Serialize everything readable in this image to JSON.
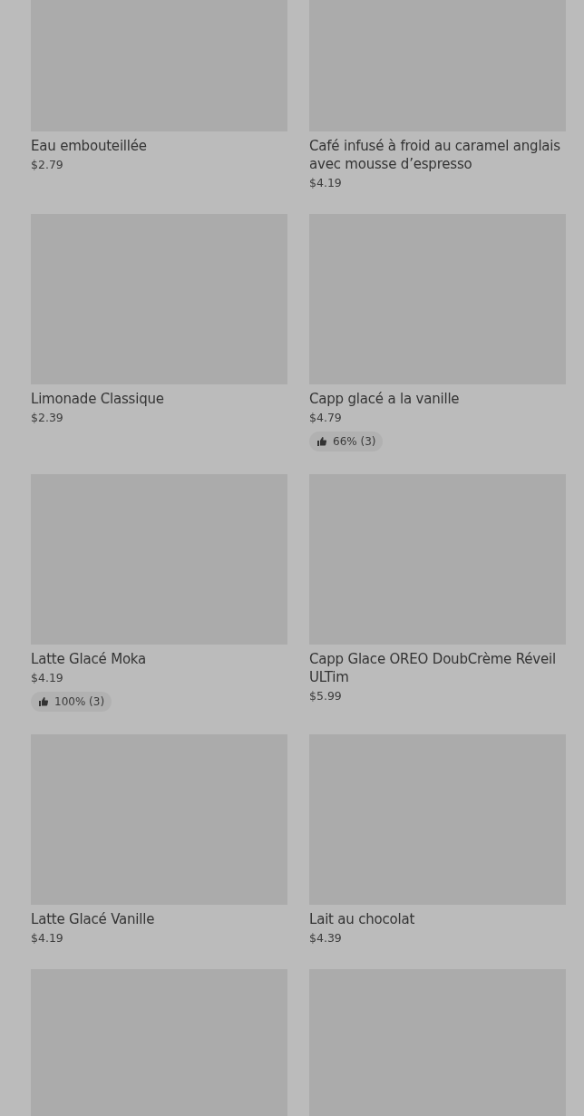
{
  "items": [
    {
      "kind": "product",
      "name": "Eau embouteillée",
      "price": "$2.79"
    },
    {
      "kind": "product",
      "name": "Café infusé à froid au caramel anglais avec mousse d’espresso",
      "price": "$4.19"
    },
    {
      "kind": "product",
      "name": "Limonade Classique",
      "price": "$2.39"
    },
    {
      "kind": "product",
      "name": "Capp glacé a la vanille",
      "price": "$4.79",
      "rating": "66% (3)"
    },
    {
      "kind": "product",
      "name": "Latte Glacé Moka",
      "price": "$4.19",
      "rating": "100% (3)"
    },
    {
      "kind": "product",
      "name": "Capp Glace OREO DoubCrème Réveil ULTim",
      "price": "$5.99"
    },
    {
      "kind": "product",
      "name": "Latte Glacé Vanille",
      "price": "$4.19"
    },
    {
      "kind": "product",
      "name": "Lait au chocolat",
      "price": "$4.39"
    },
    {
      "kind": "product"
    },
    {
      "kind": "product"
    }
  ]
}
